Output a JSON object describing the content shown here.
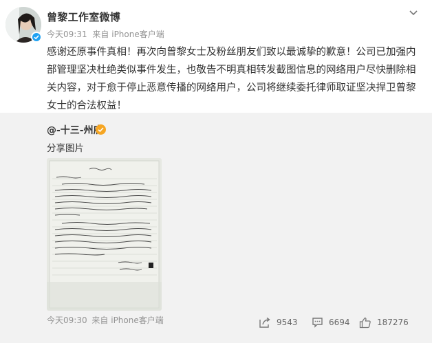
{
  "post": {
    "author": "曾黎工作室微博",
    "time": "今天09:31",
    "source": "来自 iPhone客户端",
    "text": "感谢还原事件真相！再次向曾黎女士及粉丝朋友们致以最诚挚的歉意！公司已加强内部管理坚决杜绝类似事件发生，也敬告不明真相转发截图信息的网络用户尽快删除相关内容，对于愈于停止恶意传播的网络用户，公司将继续委托律师取证坚决捍卫曾黎女士的合法权益！"
  },
  "repost": {
    "author": "@-十三-州府",
    "text": "分享图片",
    "time": "今天09:30",
    "source": "来自 iPhone客户端"
  },
  "actions": {
    "share_count": "9543",
    "comment_count": "6694",
    "like_count": "187276"
  },
  "colors": {
    "verified": "#1ea1f2",
    "repost_badge": "#f6a623",
    "meta_gray": "#939393",
    "repost_bg": "#f2f2f2"
  }
}
